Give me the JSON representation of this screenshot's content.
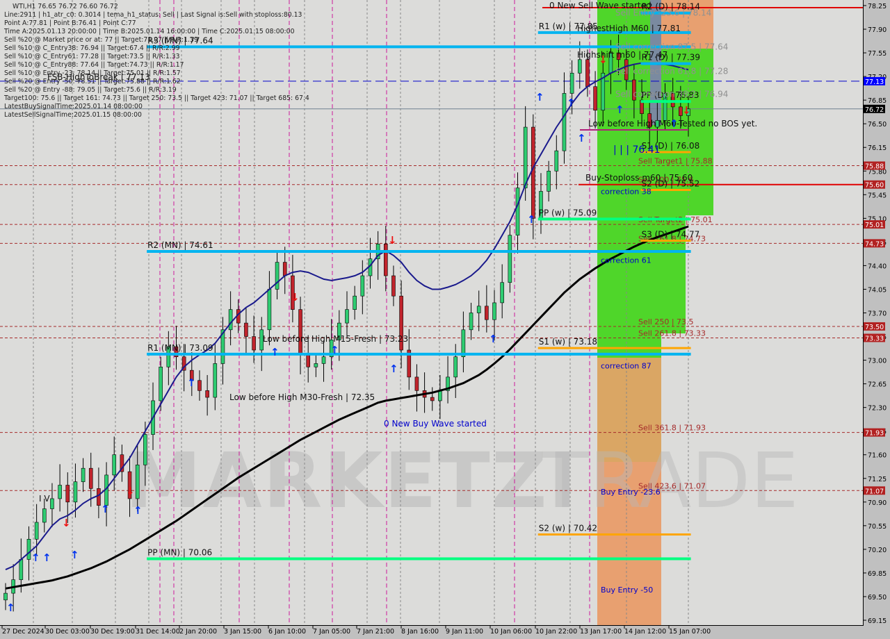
{
  "header": {
    "title": "WTI,H1  76.65 76.72 76.60 76.72",
    "info_lines": [
      "Line:2911 | h1_atr_c0: 0.3014 | tema_h1_status: Sell | Last Signal is:Sell with stoploss:80.13",
      "Point A:77.81 | Point B:76.41 | Point C:77",
      "Time A:2025.01.13 20:00:00 | Time B:2025.01.14 16:00:00 | Time C:2025.01.15 08:00:00",
      "Sell %20 @ Market price or at: 77 || Target:71.07 || R/R:1.39",
      "Sell %10 @ C_Entry38: 76.94 || Target:67.4 || R/R:2.99",
      "Sell %10 @ C_Entry61: 77.28 || Target:73.5 || R/R:1.33",
      "Sell %10 @ C_Entry88: 77.64 || Target:74.73 || R/R:1.17",
      "Sell %10 @ Entry -23: 78.14 || Target:75.01 || R/R:1.57",
      "Sell %20 @ Entry -50: 78.51 || Target:75.88 || R/R:1.62",
      "Sell %20 @ Entry -88: 79.05 || Target:75.6 || R/R:3.19",
      "Target100: 75.6 || Target 161: 74.73 || Target 250: 73.5 || Target 423: 71.07 || Target 685: 67.4",
      "LatestBuySignalTime:2025.01.14 08:00:00",
      "LatestSellSignalTime:2025.01.15 08:00:00"
    ]
  },
  "watermark": "MARKETZITRADE",
  "colors": {
    "bg": "#dcdcda",
    "bull": "#2ecc71",
    "bear": "#c0242c",
    "level_blue": "#00b4f0",
    "level_green": "#00ff80",
    "level_orange": "#ffa500",
    "sell_red": "#a52a2a",
    "zone_green": "#4fd62a",
    "zone_orange": "#e8a070",
    "ma_fast": "#1a1a8c",
    "ma_slow": "#000000",
    "price_tag_bid": "#000000",
    "price_tag_blue": "#0000ff",
    "price_tag_red": "#b22222"
  },
  "chart_data": {
    "type": "candlestick",
    "symbol": "WTI",
    "timeframe": "H1",
    "ohlc_last": {
      "open": 76.65,
      "high": 76.72,
      "low": 76.6,
      "close": 76.72
    },
    "ylim": [
      69.1,
      78.3
    ],
    "y_ticks": [
      "78.25",
      "77.90",
      "77.55",
      "77.20",
      "76.85",
      "76.50",
      "76.15",
      "75.80",
      "75.45",
      "75.10",
      "74.75",
      "74.40",
      "74.05",
      "73.70",
      "73.35",
      "73.00",
      "72.65",
      "72.30",
      "71.95",
      "71.60",
      "71.25",
      "70.90",
      "70.55",
      "70.20",
      "69.85",
      "69.50",
      "69.15"
    ],
    "x_ticks": [
      "27 Dec 2024",
      "30 Dec 03:00",
      "30 Dec 19:00",
      "31 Dec 14:00",
      "2 Jan 20:00",
      "3 Jan 15:00",
      "6 Jan 10:00",
      "7 Jan 05:00",
      "7 Jan 21:00",
      "8 Jan 16:00",
      "9 Jan 11:00",
      "10 Jan 06:00",
      "10 Jan 22:00",
      "13 Jan 17:00",
      "14 Jan 12:00",
      "15 Jan 07:00"
    ],
    "price_tags": [
      {
        "value": 77.13,
        "label": "77.13",
        "kind": "blue"
      },
      {
        "value": 76.72,
        "label": "76.72",
        "kind": "bid"
      },
      {
        "value": 75.88,
        "label": "75.88",
        "kind": "red"
      },
      {
        "value": 75.6,
        "label": "75.60",
        "kind": "red"
      },
      {
        "value": 75.01,
        "label": "75.01",
        "kind": "red"
      },
      {
        "value": 74.73,
        "label": "74.73",
        "kind": "red"
      },
      {
        "value": 73.5,
        "label": "73.50",
        "kind": "red"
      },
      {
        "value": 73.33,
        "label": "73.33",
        "kind": "red"
      },
      {
        "value": 71.93,
        "label": "71.93",
        "kind": "red"
      },
      {
        "value": 71.07,
        "label": "71.07",
        "kind": "red"
      }
    ],
    "levels": [
      {
        "label": "R3 (MN) | 77.64",
        "value": 77.64,
        "kind": "blue",
        "x0": 0.17,
        "x1": 0.8
      },
      {
        "label": "R2 (MN) | 74.61",
        "value": 74.61,
        "kind": "blue",
        "x0": 0.17,
        "x1": 0.8
      },
      {
        "label": "R1 (MN) | 73.09",
        "value": 73.09,
        "kind": "blue",
        "x0": 0.17,
        "x1": 0.8
      },
      {
        "label": "PP (MN) | 70.06",
        "value": 70.06,
        "kind": "green",
        "x0": 0.17,
        "x1": 0.8
      },
      {
        "label": "R1 (w) | 77.85",
        "value": 77.85,
        "kind": "blue",
        "x0": 0.623,
        "x1": 0.8
      },
      {
        "label": "PP (w) | 75.09",
        "value": 75.09,
        "kind": "green",
        "x0": 0.623,
        "x1": 0.8
      },
      {
        "label": "S1 (w) | 73.18",
        "value": 73.18,
        "kind": "orange",
        "x0": 0.623,
        "x1": 0.8
      },
      {
        "label": "S2 (w) | 70.42",
        "value": 70.42,
        "kind": "orange",
        "x0": 0.623,
        "x1": 0.8
      },
      {
        "label": "R2 (D) | 78.14",
        "value": 78.14,
        "kind": "blue",
        "x0": 0.742,
        "x1": 0.8
      },
      {
        "label": "R1 (D) | 77.39",
        "value": 77.39,
        "kind": "blue",
        "x0": 0.742,
        "x1": 0.8
      },
      {
        "label": "PP (D) | 76.83",
        "value": 76.83,
        "kind": "green",
        "x0": 0.742,
        "x1": 0.8
      },
      {
        "label": "S1 (D) | 76.08",
        "value": 76.08,
        "kind": "orange",
        "x0": 0.742,
        "x1": 0.8
      },
      {
        "label": "S2 (D) | 75.52",
        "value": 75.52,
        "kind": "orange",
        "x0": 0.742,
        "x1": 0.8
      },
      {
        "label": "S3 (D) | 74.77",
        "value": 74.77,
        "kind": "orange",
        "x0": 0.742,
        "x1": 0.8
      }
    ],
    "sell_levels": [
      {
        "label": "Sell Target1 | 75.88",
        "value": 75.88
      },
      {
        "label": "Sell 100 | 75.6",
        "value": 75.6
      },
      {
        "label": "Sell Target2 | 75.01",
        "value": 75.01
      },
      {
        "label": "Sell 161.8 | 74.73",
        "value": 74.73
      },
      {
        "label": "Sell 250 | 73.5",
        "value": 73.5
      },
      {
        "label": "Sell 261.8 | 73.33",
        "value": 73.33
      },
      {
        "label": "Sell 361.8 | 71.93",
        "value": 71.93
      },
      {
        "label": "Sell 423.6 | 71.07",
        "value": 71.07
      }
    ],
    "zone_labels": [
      {
        "text": "Sell Entry -23.6 | 78.14",
        "value": 78.14,
        "color": "#909090"
      },
      {
        "text": "Sell correction 87.5 | 77.64",
        "value": 77.64,
        "color": "#909090"
      },
      {
        "text": "Sell correction 61.8 | 77.28",
        "value": 77.28,
        "color": "#909090"
      },
      {
        "text": "Sell correction 38.2 | 76.94",
        "value": 76.94,
        "color": "#909090"
      },
      {
        "text": "correction 38",
        "value": 75.5,
        "color": "#0000cc"
      },
      {
        "text": "correction 61",
        "value": 74.48,
        "color": "#0000cc"
      },
      {
        "text": "correction 87",
        "value": 72.92,
        "color": "#0000cc"
      },
      {
        "text": "Buy Entry -23.6",
        "value": 71.05,
        "color": "#0000cc"
      },
      {
        "text": "Buy Entry -50",
        "value": 69.6,
        "color": "#0000cc"
      }
    ],
    "annotations": [
      {
        "text": "0 New Sell Wave started",
        "value": 78.25
      },
      {
        "text": "HighestHigh   M60 | 77.81",
        "value": 77.81
      },
      {
        "text": "Highshift m60 | 77.47",
        "value": 77.47
      },
      {
        "text": "Low before High   M60-Tested no BOS yet.",
        "value": 76.55
      },
      {
        "text": "| | | 76.41",
        "value": 76.15
      },
      {
        "text": "Buy-Stoploss m60 | 75.60",
        "value": 75.6
      },
      {
        "text": "Low before High   M15-Fresh | 73.23",
        "value": 73.23
      },
      {
        "text": "Low before High   M30-Fresh | 72.35",
        "value": 72.35
      },
      {
        "text": "0 New Buy Wave started",
        "value": 72.15
      },
      {
        "text": "FSB-HighToBreak | 77.13",
        "value": 77.13
      },
      {
        "text": "I V",
        "value": 70.95
      }
    ],
    "horizontal_lines": [
      {
        "name": "fsb-high-to-break",
        "value": 77.13,
        "style": "dashed",
        "color": "#0000cc"
      },
      {
        "name": "bid-line",
        "value": 76.72,
        "style": "solid",
        "color": "#708090"
      }
    ],
    "series": [
      {
        "name": "close",
        "values": [
          69.55,
          69.75,
          70.05,
          70.35,
          70.6,
          70.8,
          70.95,
          71.15,
          70.9,
          71.2,
          71.4,
          71.1,
          70.85,
          71.3,
          71.6,
          71.35,
          70.95,
          71.45,
          71.9,
          72.4,
          72.9,
          73.2,
          73.05,
          72.85,
          72.7,
          72.55,
          72.45,
          72.95,
          73.45,
          73.75,
          73.55,
          73.35,
          73.15,
          73.45,
          74.05,
          74.45,
          74.25,
          73.75,
          73.1,
          72.9,
          72.95,
          73.05,
          73.3,
          73.55,
          73.75,
          73.95,
          74.25,
          74.5,
          74.72,
          74.25,
          73.95,
          73.15,
          72.75,
          72.55,
          72.45,
          72.4,
          72.55,
          72.75,
          73.05,
          73.45,
          73.7,
          73.8,
          73.6,
          73.85,
          74.15,
          74.85,
          75.55,
          76.45,
          75.1,
          75.5,
          75.8,
          76.1,
          76.95,
          77.25,
          77.45,
          77.05,
          76.7,
          77.25,
          77.55,
          77.45,
          77.15,
          76.85,
          76.65,
          76.45,
          76.55,
          76.95,
          76.75,
          76.62,
          76.72
        ]
      },
      {
        "name": "ma_fast",
        "values": [
          69.9,
          69.95,
          70.05,
          70.15,
          70.25,
          70.4,
          70.55,
          70.65,
          70.7,
          70.78,
          70.88,
          70.95,
          71.0,
          71.1,
          71.25,
          71.4,
          71.55,
          71.75,
          71.95,
          72.15,
          72.35,
          72.55,
          72.75,
          72.9,
          73.0,
          73.08,
          73.15,
          73.25,
          73.4,
          73.55,
          73.68,
          73.78,
          73.85,
          73.95,
          74.05,
          74.15,
          74.25,
          74.3,
          74.32,
          74.3,
          74.25,
          74.2,
          74.18,
          74.2,
          74.22,
          74.25,
          74.3,
          74.4,
          74.55,
          74.62,
          74.55,
          74.45,
          74.3,
          74.18,
          74.1,
          74.05,
          74.05,
          74.08,
          74.12,
          74.18,
          74.25,
          74.35,
          74.48,
          74.65,
          74.85,
          75.05,
          75.3,
          75.6,
          75.85,
          76.05,
          76.25,
          76.45,
          76.62,
          76.8,
          76.95,
          77.05,
          77.12,
          77.18,
          77.25,
          77.3,
          77.35,
          77.38,
          77.4,
          77.4,
          77.38,
          77.38,
          77.36,
          77.33,
          77.3
        ]
      },
      {
        "name": "ma_slow",
        "values": [
          69.62,
          69.64,
          69.66,
          69.68,
          69.7,
          69.72,
          69.74,
          69.77,
          69.8,
          69.84,
          69.88,
          69.92,
          69.97,
          70.02,
          70.08,
          70.14,
          70.2,
          70.27,
          70.34,
          70.41,
          70.48,
          70.55,
          70.62,
          70.7,
          70.78,
          70.86,
          70.94,
          71.02,
          71.1,
          71.18,
          71.26,
          71.33,
          71.4,
          71.47,
          71.54,
          71.61,
          71.68,
          71.75,
          71.82,
          71.88,
          71.94,
          72.0,
          72.06,
          72.12,
          72.17,
          72.22,
          72.27,
          72.32,
          72.37,
          72.4,
          72.42,
          72.44,
          72.46,
          72.48,
          72.5,
          72.52,
          72.55,
          72.58,
          72.62,
          72.66,
          72.72,
          72.78,
          72.86,
          72.95,
          73.05,
          73.16,
          73.28,
          73.4,
          73.52,
          73.64,
          73.76,
          73.88,
          74.0,
          74.1,
          74.2,
          74.28,
          74.36,
          74.43,
          74.5,
          74.56,
          74.62,
          74.68,
          74.73,
          74.78,
          74.82,
          74.86,
          74.9,
          74.94,
          74.98
        ]
      }
    ]
  }
}
